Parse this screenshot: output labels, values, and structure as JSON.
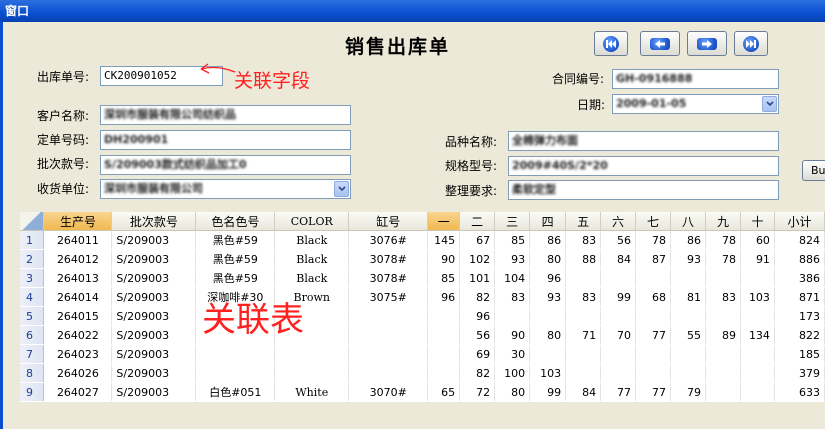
{
  "window": {
    "title": "窗口"
  },
  "form": {
    "title": "销售出库单",
    "annotation_field": "关联字段",
    "annotation_table": "关联表",
    "nav": [
      "first-record-icon",
      "prev-record-icon",
      "next-record-icon",
      "last-record-icon"
    ],
    "truncated_button": "Bu",
    "fields": {
      "outbound_no": {
        "label": "出库单号:",
        "value": "CK200901052"
      },
      "contract_no": {
        "label": "合同编号:",
        "value": "GH-0916888"
      },
      "date": {
        "label": "日期:",
        "value": "2009-01-05"
      },
      "customer": {
        "label": "客户名称:",
        "value": "深圳市服装有限公司纺织品"
      },
      "order_no": {
        "label": "定单号码:",
        "value": "DH200901"
      },
      "product": {
        "label": "品种名称:",
        "value": "全棉弹力布面"
      },
      "batch": {
        "label": "批次款号:",
        "value": "S/209003款式纺织品加工0"
      },
      "spec": {
        "label": "规格型号:",
        "value": "2009#40S/2*20"
      },
      "receiver": {
        "label": "收货单位:",
        "value": "深圳市服装有限公司"
      },
      "finish_req": {
        "label": "整理要求:",
        "value": "柔软定型"
      }
    }
  },
  "grid": {
    "columns": [
      "生产号",
      "批次款号",
      "色名色号",
      "COLOR",
      "缸号",
      "一",
      "二",
      "三",
      "四",
      "五",
      "六",
      "七",
      "八",
      "九",
      "十",
      "小计"
    ],
    "rows": [
      {
        "n": "1",
        "cells": [
          "264011",
          "S/209003",
          "黑色#59",
          "Black",
          "3076#",
          "145",
          "67",
          "85",
          "86",
          "83",
          "56",
          "78",
          "86",
          "78",
          "60",
          "824"
        ]
      },
      {
        "n": "2",
        "cells": [
          "264012",
          "S/209003",
          "黑色#59",
          "Black",
          "3078#",
          "90",
          "102",
          "93",
          "80",
          "88",
          "84",
          "87",
          "93",
          "78",
          "91",
          "886"
        ]
      },
      {
        "n": "3",
        "cells": [
          "264013",
          "S/209003",
          "黑色#59",
          "Black",
          "3078#",
          "85",
          "101",
          "104",
          "96",
          "",
          "",
          "",
          "",
          "",
          "",
          "386"
        ]
      },
      {
        "n": "4",
        "cells": [
          "264014",
          "S/209003",
          "深咖啡#30",
          "Brown",
          "3075#",
          "96",
          "82",
          "83",
          "93",
          "83",
          "99",
          "68",
          "81",
          "83",
          "103",
          "871"
        ]
      },
      {
        "n": "5",
        "cells": [
          "264015",
          "S/209003",
          "",
          "",
          "",
          "",
          "96",
          "",
          "",
          "",
          "",
          "",
          "",
          "",
          "",
          "173"
        ]
      },
      {
        "n": "6",
        "cells": [
          "264022",
          "S/209003",
          "",
          "",
          "",
          "",
          "56",
          "90",
          "80",
          "71",
          "70",
          "77",
          "55",
          "89",
          "134",
          "822"
        ]
      },
      {
        "n": "7",
        "cells": [
          "264023",
          "S/209003",
          "",
          "",
          "",
          "",
          "69",
          "30",
          "",
          "",
          "",
          "",
          "",
          "",
          "",
          "185"
        ]
      },
      {
        "n": "8",
        "cells": [
          "264026",
          "S/209003",
          "",
          "",
          "",
          "",
          "82",
          "100",
          "103",
          "",
          "",
          "",
          "",
          "",
          "",
          "379"
        ]
      },
      {
        "n": "9",
        "cells": [
          "264027",
          "S/209003",
          "白色#051",
          "White",
          "3070#",
          "65",
          "72",
          "80",
          "99",
          "84",
          "77",
          "77",
          "79",
          "",
          "",
          "633"
        ]
      }
    ]
  }
}
